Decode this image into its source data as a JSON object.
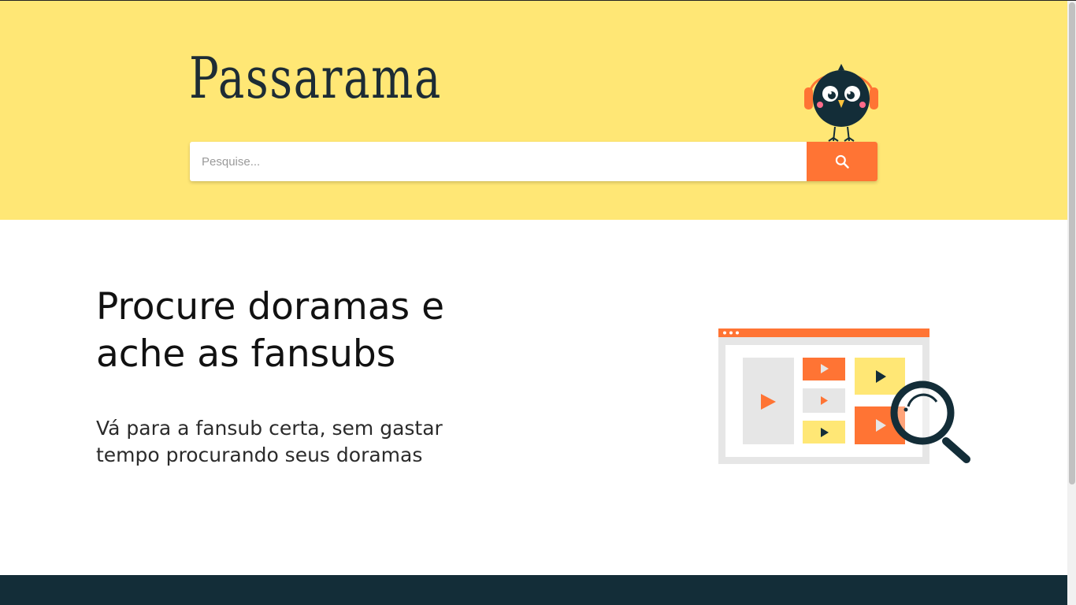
{
  "header": {
    "logo_text": "Passarama",
    "mascot_icon": "bird-with-headphones-icon"
  },
  "search": {
    "placeholder": "Pesquise...",
    "value": "",
    "button_icon": "search-icon"
  },
  "hero": {
    "title_line1": "Procure doramas e",
    "title_line2": "ache as fansubs",
    "subtitle_line1": "Vá para a fansub certa, sem gastar",
    "subtitle_line2": "tempo procurando seus doramas",
    "illustration_icon": "video-search-illustration"
  },
  "colors": {
    "header_bg": "#ffe775",
    "accent": "#ff7434",
    "dark": "#132d38",
    "text": "#111111"
  }
}
